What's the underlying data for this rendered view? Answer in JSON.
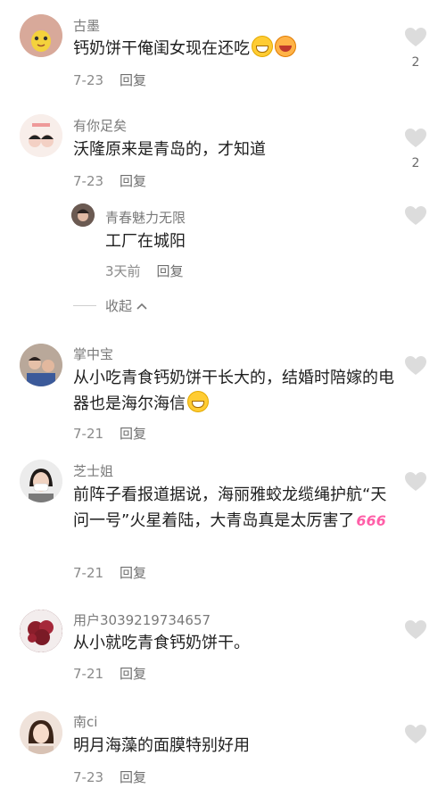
{
  "colors": {
    "like_heart": "#dcdcdc",
    "username": "#7a7a7a",
    "meta": "#8a8a8a"
  },
  "comments": [
    {
      "user": "古墨",
      "text": "钙奶饼干俺闺女现在还吃",
      "date": "7-23",
      "reply_label": "回复",
      "likes": "2"
    },
    {
      "user": "有你足矣",
      "text": "沃隆原来是青岛的，才知道",
      "date": "7-23",
      "reply_label": "回复",
      "likes": "2",
      "replies": [
        {
          "user": "青春魅力无限",
          "text": "工厂在城阳",
          "date": "3天前",
          "reply_label": "回复"
        }
      ],
      "collapse_label": "收起"
    },
    {
      "user": "掌中宝",
      "text": "从小吃青食钙奶饼干长大的，结婚时陪嫁的电器也是海尔海信",
      "date": "7-21",
      "reply_label": "回复"
    },
    {
      "user": "芝士姐",
      "text": "前阵子看报道据说，海丽雅蛟龙缆绳护航“天问一号”火星着陆，大青岛真是太厉害了",
      "emoji_text": "666",
      "date": "7-21",
      "reply_label": "回复"
    },
    {
      "user": "用户3039219734657",
      "text": "从小就吃青食钙奶饼干。",
      "date": "7-21",
      "reply_label": "回复"
    },
    {
      "user": "南ci",
      "text": "明月海藻的面膜特别好用",
      "date": "7-23",
      "reply_label": "回复"
    }
  ]
}
